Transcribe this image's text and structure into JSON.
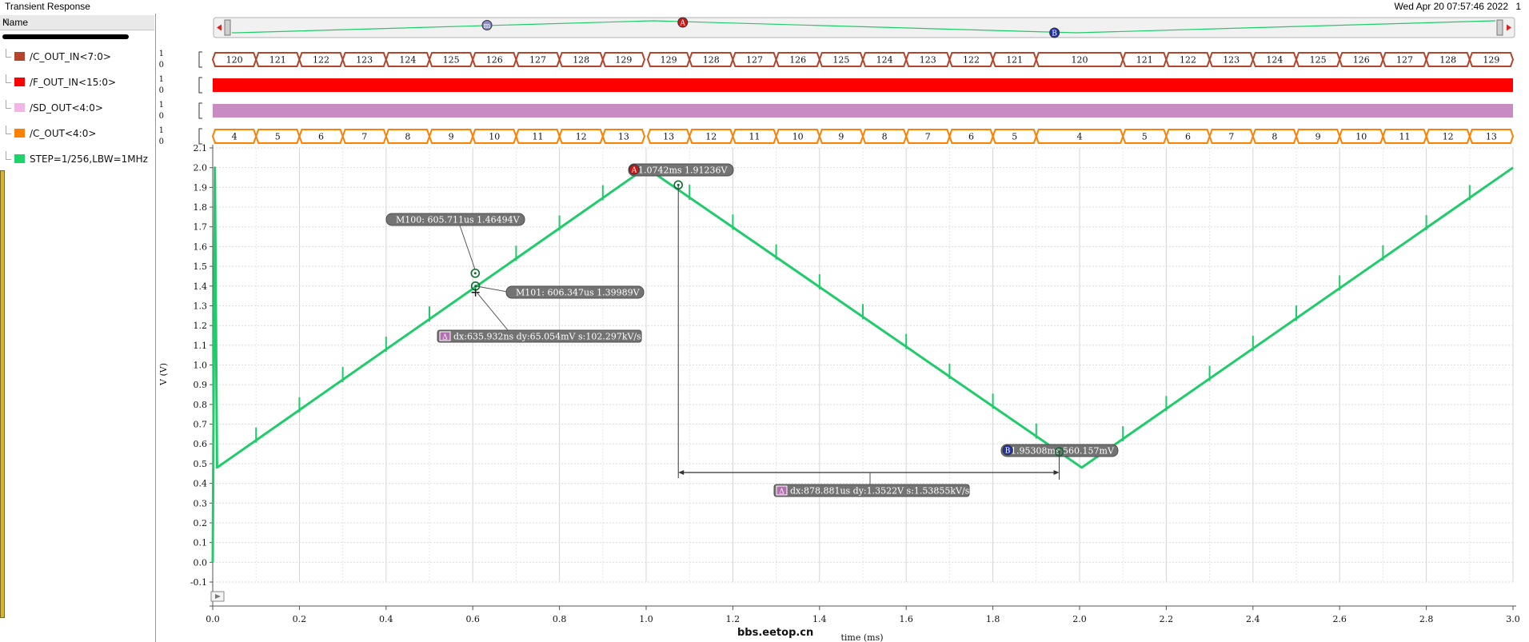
{
  "app": {
    "title": "Transient Response",
    "timestamp": "Wed Apr 20 07:57:46 2022",
    "page": "1",
    "watermark": "bbs.eetop.cn"
  },
  "sidebar": {
    "header": "Name",
    "signals": [
      {
        "label": "/C_OUT_IN<7:0>",
        "color": "#b5442d"
      },
      {
        "label": "/F_OUT_IN<15:0>",
        "color": "#ff0000"
      },
      {
        "label": "/SD_OUT<4:0>",
        "color": "#f2b6e6"
      },
      {
        "label": "/C_OUT<4:0>",
        "color": "#ff8000"
      },
      {
        "label": "STEP=1/256,LBW=1MHz",
        "color": "#1fd36b"
      }
    ]
  },
  "colors": {
    "trace": "#1fcc6a",
    "bus_c_out_in": "#b5442d",
    "bus_f_out_in": "#ff0000",
    "bus_sd_out": "#c88bc2",
    "bus_c_out": "#ff8000",
    "marker_fill": "#737373",
    "cursor_a": "#c81818",
    "cursor_b": "#2030b0",
    "delta_badge": "#b46fb0"
  },
  "chart_data": {
    "type": "line",
    "xlabel": "time (ms)",
    "ylabel": "V (V)",
    "xlim": [
      0,
      3.0
    ],
    "ylim": [
      -0.1,
      2.1
    ],
    "xticks": [
      "0.0",
      "0.2",
      "0.4",
      "0.6",
      "0.8",
      "1.0",
      "1.2",
      "1.4",
      "1.6",
      "1.8",
      "2.0",
      "2.2",
      "2.4",
      "2.6",
      "2.8",
      "3.0"
    ],
    "yticks": [
      "-0.1",
      "0.0",
      "0.1",
      "0.2",
      "0.3",
      "0.4",
      "0.5",
      "0.6",
      "0.7",
      "0.8",
      "0.9",
      "1.0",
      "1.1",
      "1.2",
      "1.3",
      "1.4",
      "1.5",
      "1.6",
      "1.7",
      "1.8",
      "1.9",
      "2.0",
      "2.1"
    ],
    "grid": true,
    "series": [
      {
        "name": "STEP=1/256,LBW=1MHz",
        "x": [
          0.0,
          0.005,
          0.01,
          1.0,
          2.005,
          3.0
        ],
        "y": [
          0.0,
          2.0,
          0.48,
          2.0,
          0.48,
          2.0
        ]
      }
    ],
    "spike_times": [
      0.1,
      0.2,
      0.3,
      0.4,
      0.5,
      0.7,
      0.8,
      0.9,
      1.1,
      1.2,
      1.3,
      1.4,
      1.5,
      1.6,
      1.7,
      1.8,
      1.9,
      2.1,
      2.2,
      2.3,
      2.4,
      2.5,
      2.6,
      2.7,
      2.8,
      2.9
    ],
    "markers": [
      {
        "id": "M100",
        "x": 0.6057,
        "y": 1.46494,
        "label": "M100: 605.711us 1.46494V"
      },
      {
        "id": "M101",
        "x": 0.6063,
        "y": 1.39989,
        "label": "M101: 606.347us 1.39989V"
      },
      {
        "id": "A",
        "x": 1.0742,
        "y": 1.91236,
        "label": "1.0742ms 1.91236V"
      },
      {
        "id": "B",
        "x": 1.95308,
        "y": 0.560157,
        "label": "1.95308ms 560.157mV"
      }
    ],
    "deltas": [
      {
        "label": "dx:635.932ns dy:65.054mV s:102.297kV/s"
      },
      {
        "label": "dx:878.881us dy:1.3522V s:1.53855kV/s"
      }
    ],
    "overview": {
      "marker_a": "A",
      "marker_b": "B",
      "marker_m": "m"
    },
    "buses": [
      {
        "name": "/C_OUT_IN<7:0>",
        "range": [
          "1",
          "0"
        ],
        "values": [
          "120",
          "121",
          "122",
          "123",
          "124",
          "125",
          "126",
          "127",
          "128",
          "129",
          "129",
          "128",
          "127",
          "126",
          "125",
          "124",
          "123",
          "122",
          "121",
          "120",
          "121",
          "122",
          "123",
          "124",
          "125",
          "126",
          "127",
          "128",
          "129"
        ]
      },
      {
        "name": "/F_OUT_IN<15:0>",
        "range": [
          "1",
          "0"
        ],
        "values": []
      },
      {
        "name": "/SD_OUT<4:0>",
        "range": [
          "1",
          "0"
        ],
        "values": []
      },
      {
        "name": "/C_OUT<4:0>",
        "range": [
          "1",
          "0"
        ],
        "values": [
          "4",
          "5",
          "6",
          "7",
          "8",
          "9",
          "10",
          "11",
          "12",
          "13",
          "13",
          "12",
          "11",
          "10",
          "9",
          "8",
          "7",
          "6",
          "5",
          "4",
          "5",
          "6",
          "7",
          "8",
          "9",
          "10",
          "11",
          "12",
          "13"
        ]
      }
    ]
  }
}
